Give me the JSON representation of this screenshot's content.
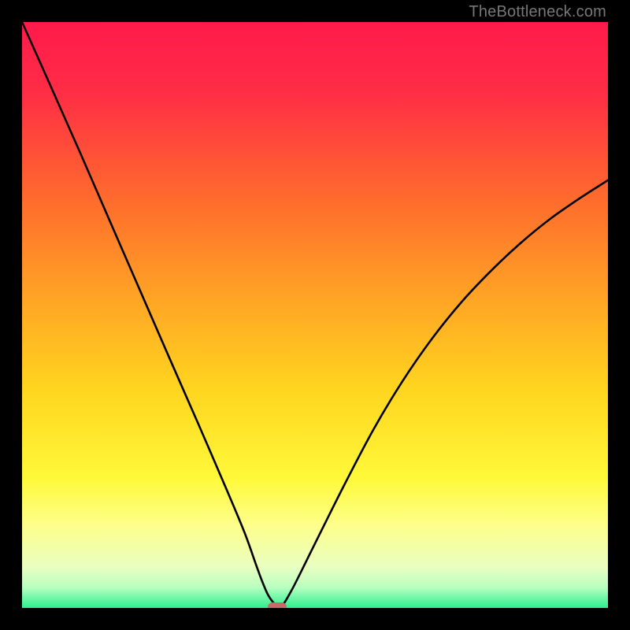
{
  "watermark": "TheBottleneck.com",
  "chart_data": {
    "type": "line",
    "title": "",
    "xlabel": "",
    "ylabel": "",
    "x_range": [
      0,
      1
    ],
    "y_range": [
      0,
      1
    ],
    "gradient": [
      {
        "stop": 0.0,
        "color": "#ff1a4b"
      },
      {
        "stop": 0.12,
        "color": "#ff2d46"
      },
      {
        "stop": 0.3,
        "color": "#ff6a2d"
      },
      {
        "stop": 0.48,
        "color": "#ffa724"
      },
      {
        "stop": 0.63,
        "color": "#ffd61f"
      },
      {
        "stop": 0.78,
        "color": "#fff93a"
      },
      {
        "stop": 0.86,
        "color": "#fdff8c"
      },
      {
        "stop": 0.93,
        "color": "#eaffc0"
      },
      {
        "stop": 0.965,
        "color": "#b7ffc0"
      },
      {
        "stop": 1.0,
        "color": "#2cf08e"
      }
    ],
    "series": [
      {
        "name": "bottleneck-curve",
        "color": "#000000",
        "x": [
          0.0,
          0.05,
          0.1,
          0.15,
          0.2,
          0.25,
          0.3,
          0.35,
          0.38,
          0.4,
          0.41,
          0.42,
          0.43,
          0.44,
          0.46,
          0.5,
          0.55,
          0.6,
          0.65,
          0.7,
          0.75,
          0.8,
          0.85,
          0.9,
          0.95,
          1.0
        ],
        "y": [
          1.0,
          0.888,
          0.775,
          0.66,
          0.545,
          0.43,
          0.316,
          0.2,
          0.128,
          0.072,
          0.045,
          0.022,
          0.008,
          0.0,
          0.03,
          0.11,
          0.21,
          0.305,
          0.388,
          0.46,
          0.522,
          0.575,
          0.622,
          0.663,
          0.698,
          0.73
        ]
      }
    ],
    "minimum_marker": {
      "x": 0.435,
      "y": 0.002,
      "color": "#c96a6a"
    }
  }
}
